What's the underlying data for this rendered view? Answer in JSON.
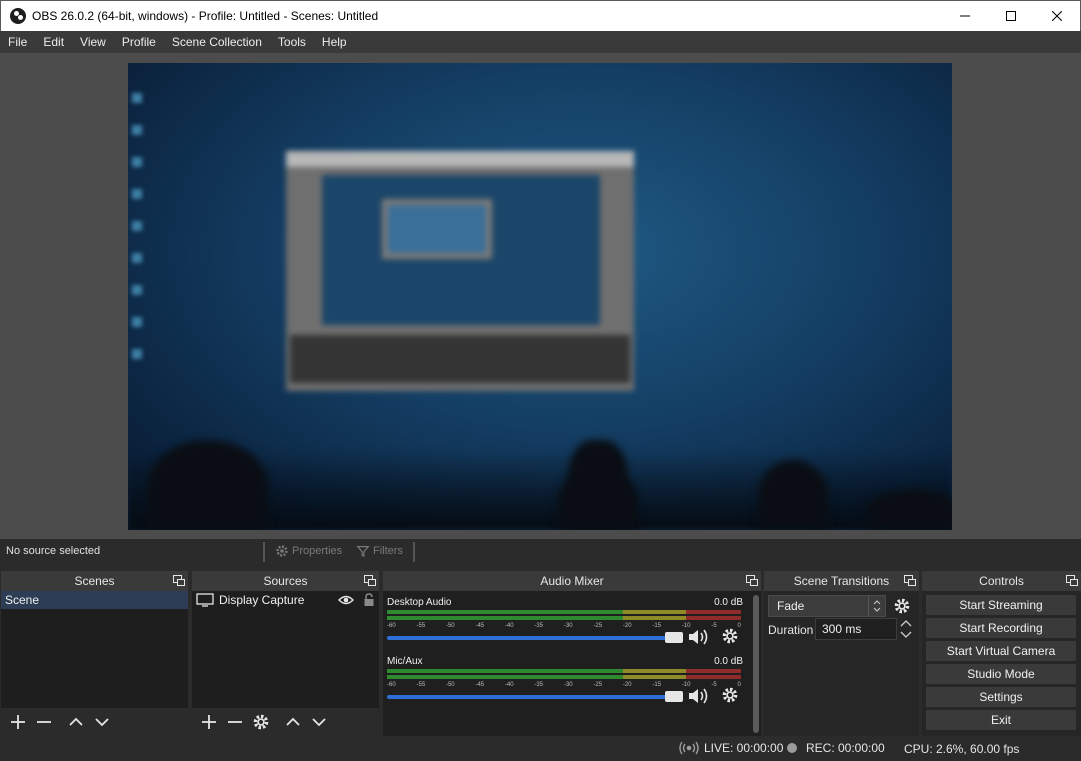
{
  "window": {
    "title": "OBS 26.0.2 (64-bit, windows) - Profile: Untitled - Scenes: Untitled"
  },
  "menu": [
    "File",
    "Edit",
    "View",
    "Profile",
    "Scene Collection",
    "Tools",
    "Help"
  ],
  "source_toolbar": {
    "status": "No source selected",
    "properties_label": "Properties",
    "filters_label": "Filters"
  },
  "docks": {
    "scenes": {
      "title": "Scenes",
      "items": [
        "Scene"
      ]
    },
    "sources": {
      "title": "Sources",
      "items": [
        "Display Capture"
      ]
    },
    "mixer": {
      "title": "Audio Mixer",
      "ticks": [
        "-60",
        "-55",
        "-50",
        "-45",
        "-40",
        "-35",
        "-30",
        "-25",
        "-20",
        "-15",
        "-10",
        "-5",
        "0"
      ],
      "channels": [
        {
          "name": "Desktop Audio",
          "level": "0.0 dB",
          "volume": 1.0
        },
        {
          "name": "Mic/Aux",
          "level": "0.0 dB",
          "volume": 1.0
        }
      ]
    },
    "transitions": {
      "title": "Scene Transitions",
      "selected": "Fade",
      "duration_label": "Duration",
      "duration_value": "300 ms"
    },
    "controls": {
      "title": "Controls",
      "buttons": [
        "Start Streaming",
        "Start Recording",
        "Start Virtual Camera",
        "Studio Mode",
        "Settings",
        "Exit"
      ]
    }
  },
  "status": {
    "live": "LIVE: 00:00:00",
    "rec": "REC: 00:00:00",
    "cpu": "CPU: 2.6%, 60.00 fps"
  },
  "colors": {
    "accent": "#2d6fd6",
    "meter_green": "#2f8a2f",
    "meter_yellow": "#8f8a28",
    "meter_red": "#8f2b2b"
  }
}
